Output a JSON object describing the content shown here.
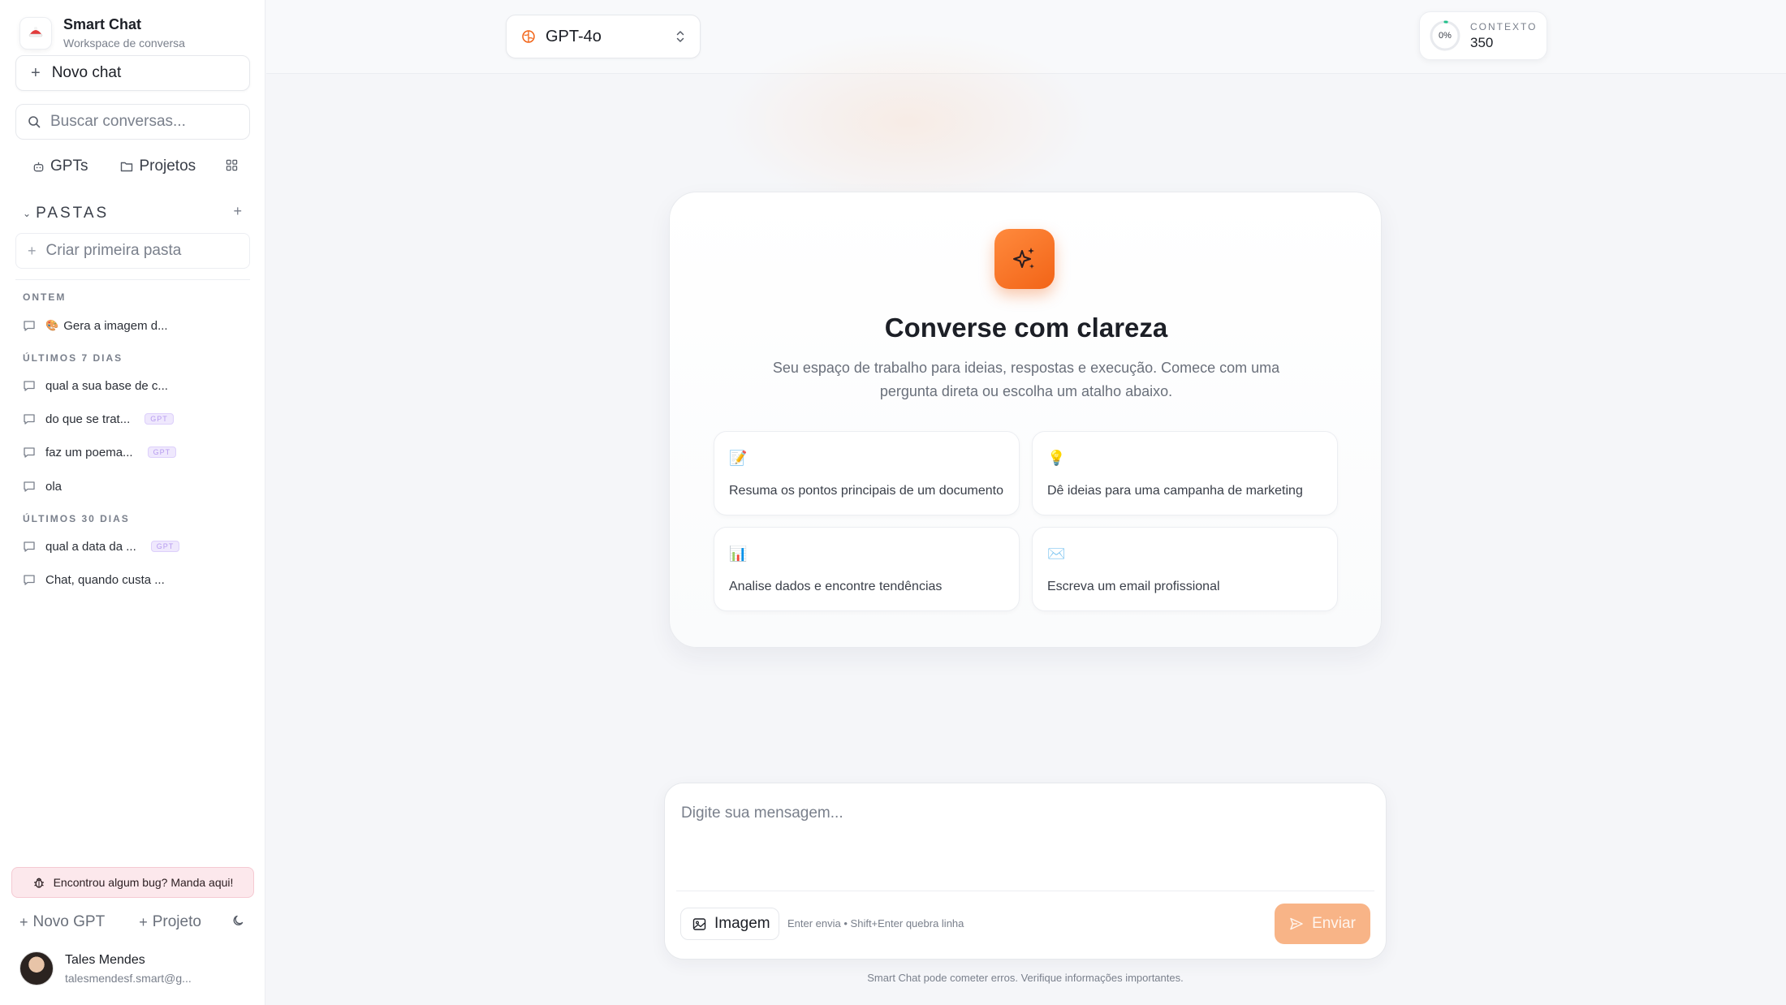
{
  "sidebar": {
    "brand": {
      "name": "Smart Chat",
      "subtitle": "Workspace de conversa"
    },
    "new_chat_label": "Novo chat",
    "search_placeholder": "Buscar conversas...",
    "links": {
      "gpts": "GPTs",
      "projetos": "Projetos"
    },
    "folders": {
      "title": "PASTAS",
      "create_label": "Criar primeira pasta"
    },
    "sections": [
      {
        "label": "ONTEM",
        "items": [
          {
            "title": "Gera a imagem d...",
            "emoji": "🎨"
          }
        ]
      },
      {
        "label": "ÚLTIMOS 7 DIAS",
        "items": [
          {
            "title": "qual a sua base de c..."
          },
          {
            "title": "do que se trat...",
            "badge": "GPT"
          },
          {
            "title": "faz um poema...",
            "badge": "GPT"
          },
          {
            "title": "ola"
          }
        ]
      },
      {
        "label": "ÚLTIMOS 30 DIAS",
        "items": [
          {
            "title": "qual a data da ...",
            "badge": "GPT"
          },
          {
            "title": "Chat, quando custa ..."
          }
        ]
      }
    ],
    "bug_banner": "Encontrou algum bug? Manda aqui!",
    "bottom": {
      "new_gpt": "Novo GPT",
      "project": "Projeto"
    },
    "user": {
      "name": "Tales Mendes",
      "email": "talesmendesf.smart@g..."
    }
  },
  "topbar": {
    "model": "GPT-4o",
    "context": {
      "label": "CONTEXTO",
      "percent": "0%",
      "value": "350",
      "fraction": 0.02
    }
  },
  "welcome": {
    "title": "Converse com clareza",
    "subtitle": "Seu espaço de trabalho para ideias, respostas e execução. Comece com uma pergunta direta ou escolha um atalho abaixo.",
    "cards": [
      {
        "emoji": "📝",
        "text": "Resuma os pontos principais de um documento"
      },
      {
        "emoji": "💡",
        "text": "Dê ideias para uma campanha de marketing"
      },
      {
        "emoji": "📊",
        "text": "Analise dados e encontre tendências"
      },
      {
        "emoji": "✉️",
        "text": "Escreva um email profissional"
      }
    ]
  },
  "composer": {
    "placeholder": "Digite sua mensagem...",
    "image_button": "Imagem",
    "hint": "Enter envia • Shift+Enter quebra linha",
    "send_button": "Enviar"
  },
  "disclaimer": "Smart Chat pode cometer erros. Verifique informações importantes.",
  "colors": {
    "accent": "#f26417",
    "send_disabled": "#f8b487",
    "background": "#f5f6f9"
  }
}
